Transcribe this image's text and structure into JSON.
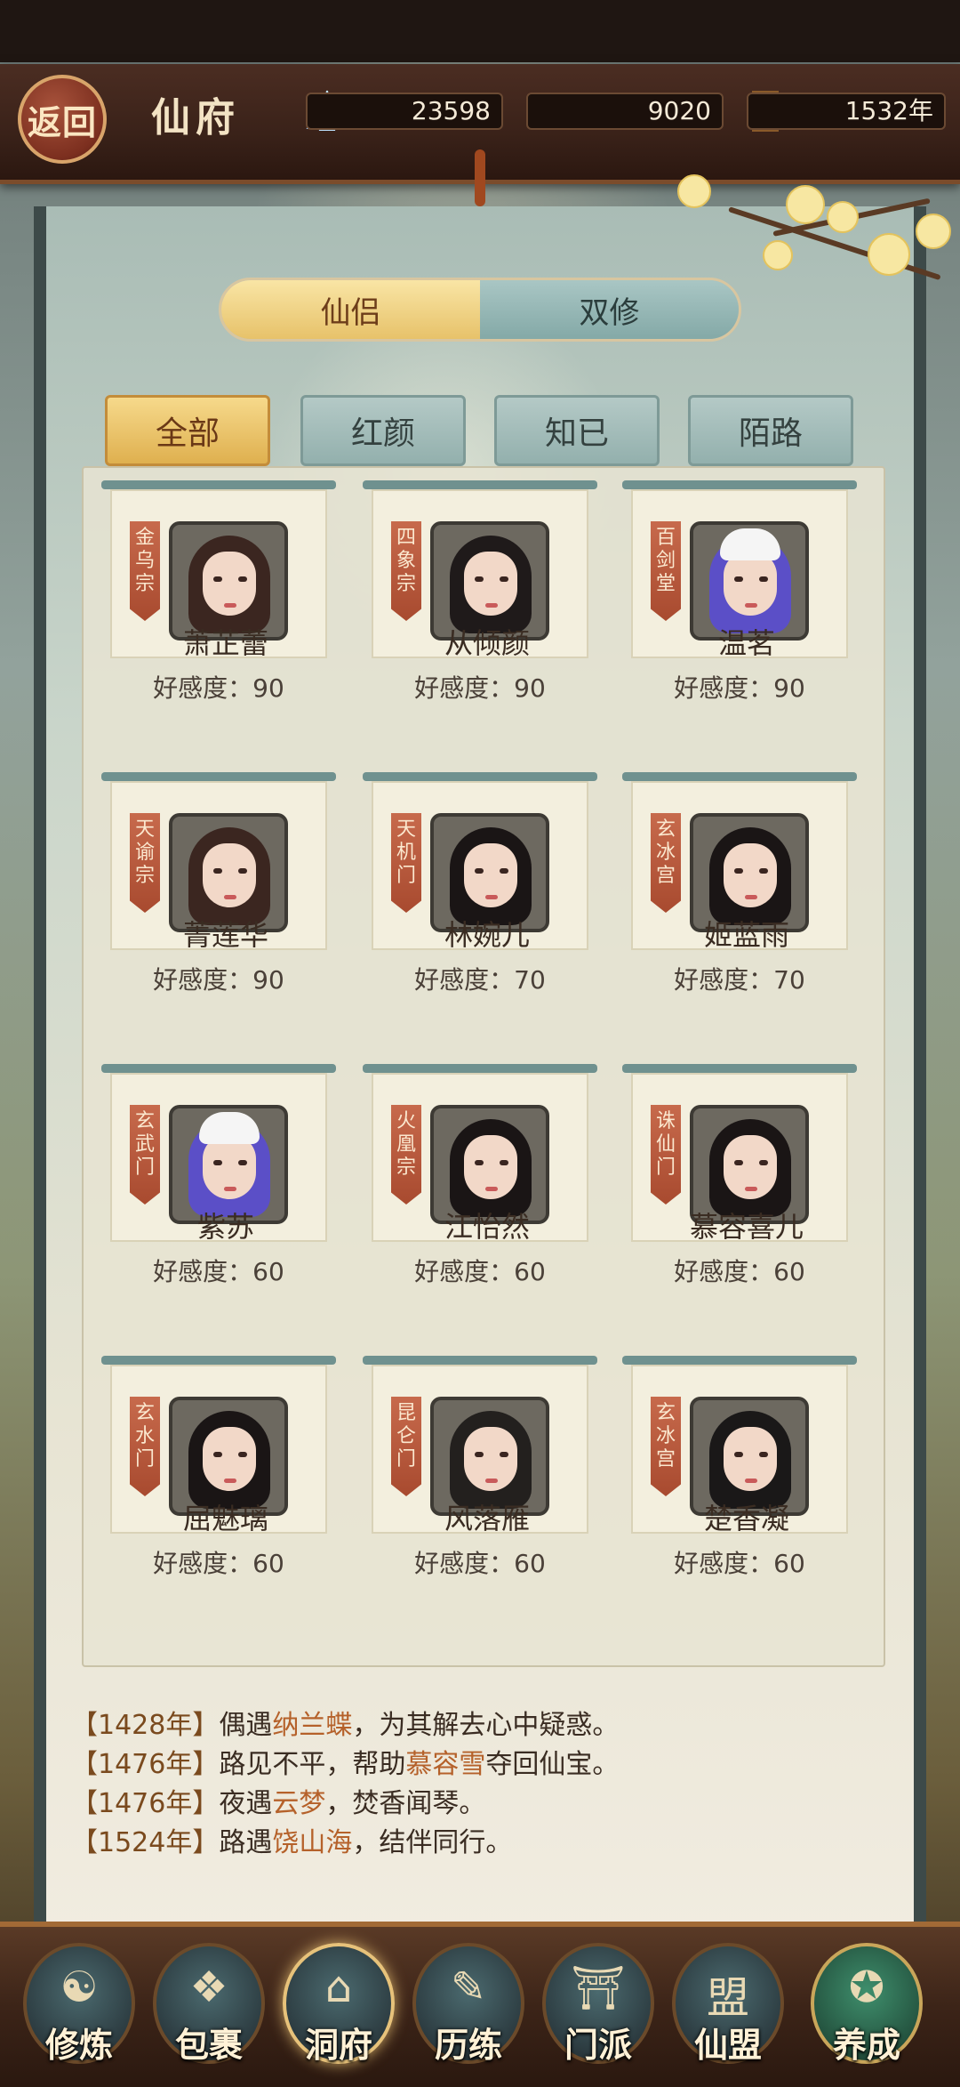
{
  "header": {
    "back_label": "返回",
    "title": "仙府",
    "resources": [
      {
        "icon": "crystal-icon",
        "value": "23598"
      },
      {
        "icon": "spirit-stone-icon",
        "value": "9020"
      },
      {
        "icon": "hourglass-icon",
        "value": "1532年"
      }
    ]
  },
  "tabs": [
    {
      "label": "仙侣",
      "active": true
    },
    {
      "label": "双修",
      "active": false
    }
  ],
  "filters": [
    {
      "label": "全部",
      "active": true
    },
    {
      "label": "红颜",
      "active": false
    },
    {
      "label": "知已",
      "active": false
    },
    {
      "label": "陌路",
      "active": false
    }
  ],
  "affinity_prefix": "好感度:",
  "companions": [
    {
      "sect": "金乌宗",
      "name": "萧芷蕾",
      "affinity": "好感度：90"
    },
    {
      "sect": "四象宗",
      "name": "从倾颜",
      "affinity": "好感度：90"
    },
    {
      "sect": "百剑堂",
      "name": "温茗",
      "affinity": "好感度：90"
    },
    {
      "sect": "天谕宗",
      "name": "菁莲华",
      "affinity": "好感度：90"
    },
    {
      "sect": "天机门",
      "name": "林婉儿",
      "affinity": "好感度：70"
    },
    {
      "sect": "玄冰宫",
      "name": "姬蓝雨",
      "affinity": "好感度：70"
    },
    {
      "sect": "玄武门",
      "name": "紫苏",
      "affinity": "好感度：60"
    },
    {
      "sect": "火凰宗",
      "name": "江怡然",
      "affinity": "好感度：60"
    },
    {
      "sect": "诛仙门",
      "name": "慕容喜儿",
      "affinity": "好感度：60"
    },
    {
      "sect": "玄水门",
      "name": "屈魅璃",
      "affinity": "好感度：60"
    },
    {
      "sect": "昆仑门",
      "name": "风落雁",
      "affinity": "好感度：60"
    },
    {
      "sect": "玄冰宫",
      "name": "楚香凝",
      "affinity": "好感度：60"
    }
  ],
  "log": [
    {
      "year": "【1428年】",
      "pre": "偶遇",
      "who": "纳兰蝶",
      "post": "，为其解去心中疑惑。"
    },
    {
      "year": "【1476年】",
      "pre": "路见不平，帮助",
      "who": "慕容雪",
      "post": "夺回仙宝。"
    },
    {
      "year": "【1476年】",
      "pre": "夜遇",
      "who": "云梦",
      "post": "，焚香闻琴。"
    },
    {
      "year": "【1524年】",
      "pre": "路遇",
      "who": "饶山海",
      "post": "，结伴同行。"
    }
  ],
  "nav": [
    {
      "label": "修炼",
      "icon": "cultivate-icon",
      "glyph": "☯"
    },
    {
      "label": "包裹",
      "icon": "bag-icon",
      "glyph": "❖"
    },
    {
      "label": "洞府",
      "icon": "cave-house-icon",
      "glyph": "⌂"
    },
    {
      "label": "历练",
      "icon": "scroll-icon",
      "glyph": "✎"
    },
    {
      "label": "门派",
      "icon": "sect-gate-icon",
      "glyph": "⛩"
    },
    {
      "label": "仙盟",
      "icon": "alliance-icon",
      "glyph": "盟"
    },
    {
      "label": "养成",
      "icon": "pentagram-icon",
      "glyph": "✪"
    }
  ],
  "colors": {
    "accent_gold": "#e7c26a",
    "highlight_text": "#b5612a",
    "sect_banner": "#c76a4c"
  }
}
